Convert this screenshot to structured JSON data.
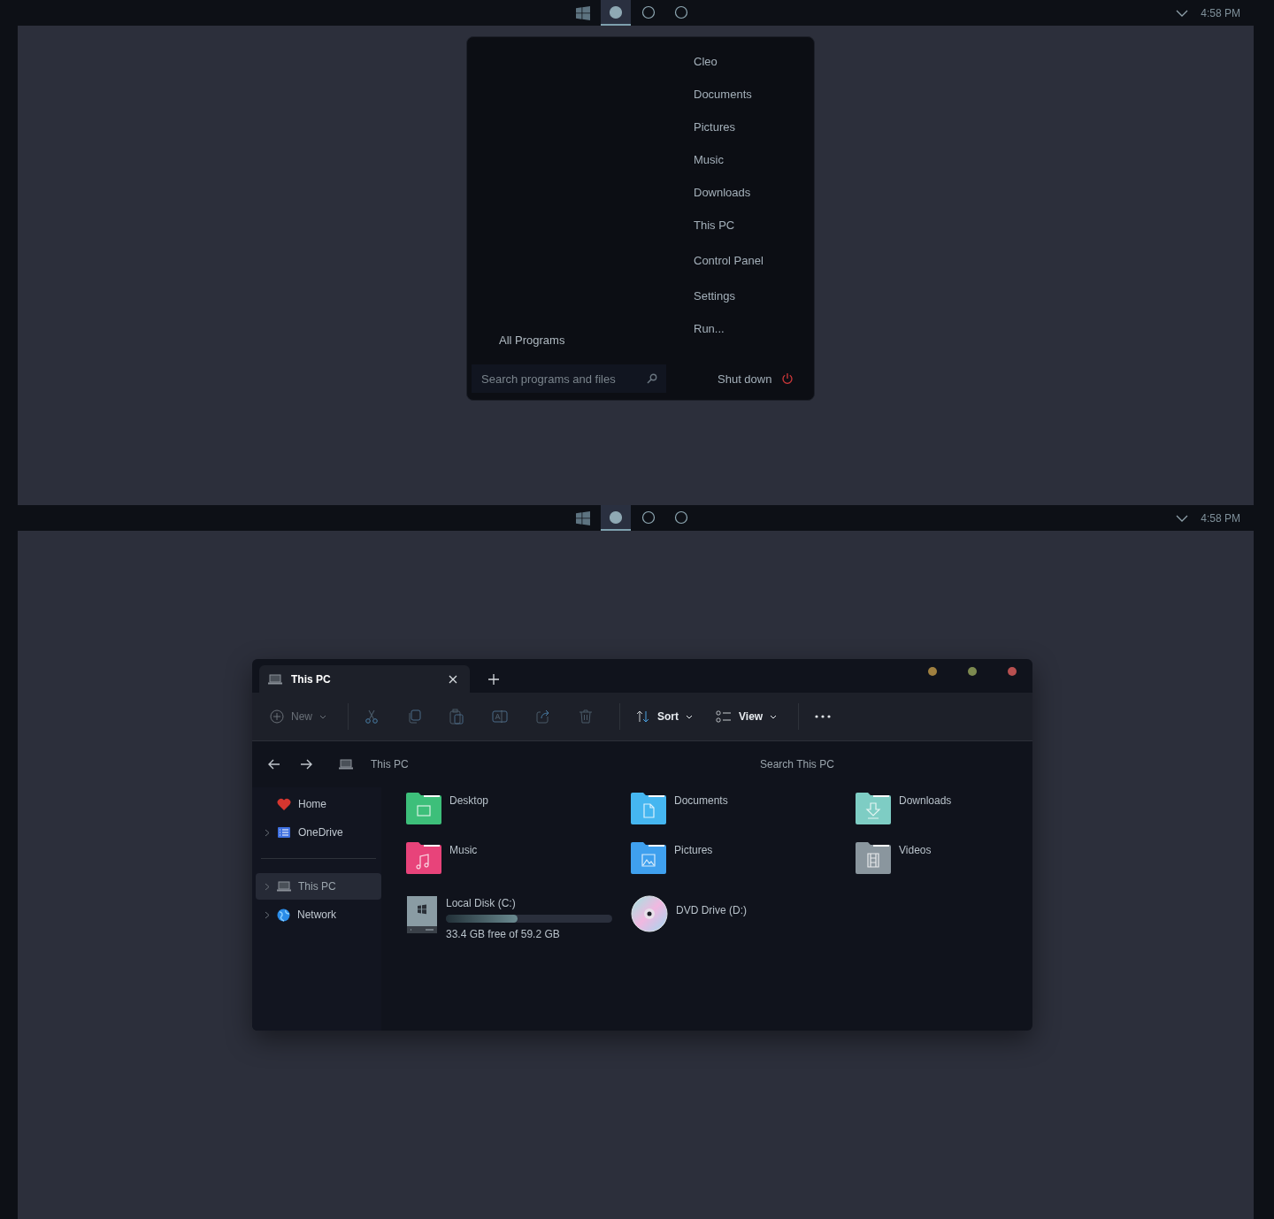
{
  "screens": [
    {
      "taskbar": {
        "task_buttons": [
          {
            "selected": true
          },
          {
            "selected": false
          },
          {
            "selected": false
          }
        ],
        "clock": "4:58 PM"
      },
      "start_menu": {
        "places": [
          "Cleo",
          "Documents",
          "Pictures",
          "Music",
          "Downloads",
          "This PC",
          "Control Panel",
          "Settings",
          "Run..."
        ],
        "all_programs": "All Programs",
        "search": {
          "placeholder": "Search programs and files"
        },
        "shut_down": "Shut down"
      }
    },
    {
      "taskbar": {
        "task_buttons": [
          {
            "selected": true
          },
          {
            "selected": false
          },
          {
            "selected": false
          }
        ],
        "clock": "4:58 PM"
      },
      "explorer": {
        "tabs": [
          {
            "label": "This PC",
            "selected": true
          }
        ],
        "window_dots": [
          {
            "color": "#a08040"
          },
          {
            "color": "#7d8a50"
          },
          {
            "color": "#b85050"
          }
        ],
        "toolbar": {
          "new": {
            "label": "New",
            "disabled": true
          },
          "actions": [
            {
              "kind": "cut"
            },
            {
              "kind": "copy"
            },
            {
              "kind": "paste"
            },
            {
              "kind": "rename"
            },
            {
              "kind": "share"
            },
            {
              "kind": "delete"
            }
          ],
          "sort": {
            "label": "Sort",
            "disabled": false
          },
          "view": {
            "label": "View",
            "disabled": false
          }
        },
        "address": "This PC",
        "search": {
          "placeholder": "Search This PC"
        },
        "sidebar": {
          "groups": [
            [
              {
                "label": "Home",
                "kind": "home",
                "expandable": false,
                "selected": false
              },
              {
                "label": "OneDrive",
                "kind": "cloud",
                "expandable": true,
                "selected": false
              }
            ],
            [
              {
                "label": "This PC",
                "kind": "pc",
                "expandable": true,
                "selected": true
              },
              {
                "label": "Network",
                "kind": "network",
                "expandable": true,
                "selected": false
              }
            ]
          ]
        },
        "items": [
          {
            "kind": "desktop",
            "label": "Desktop",
            "color": "#3dbf7a"
          },
          {
            "kind": "documents",
            "label": "Documents",
            "color": "#45b6f0"
          },
          {
            "kind": "downloads",
            "label": "Downloads",
            "color": "#7ecdc4"
          },
          {
            "kind": "music",
            "label": "Music",
            "color": "#e8437a"
          },
          {
            "kind": "pictures",
            "label": "Pictures",
            "color": "#3fa0ee"
          },
          {
            "kind": "videos",
            "label": "Videos",
            "color": "#8a969e"
          },
          {
            "kind": "disk",
            "label": "Local Disk (C:)",
            "level": 0.43,
            "free": "33.4 GB free of 59.2 GB"
          },
          {
            "kind": "dvd",
            "label": "DVD Drive (D:)"
          }
        ]
      }
    }
  ]
}
